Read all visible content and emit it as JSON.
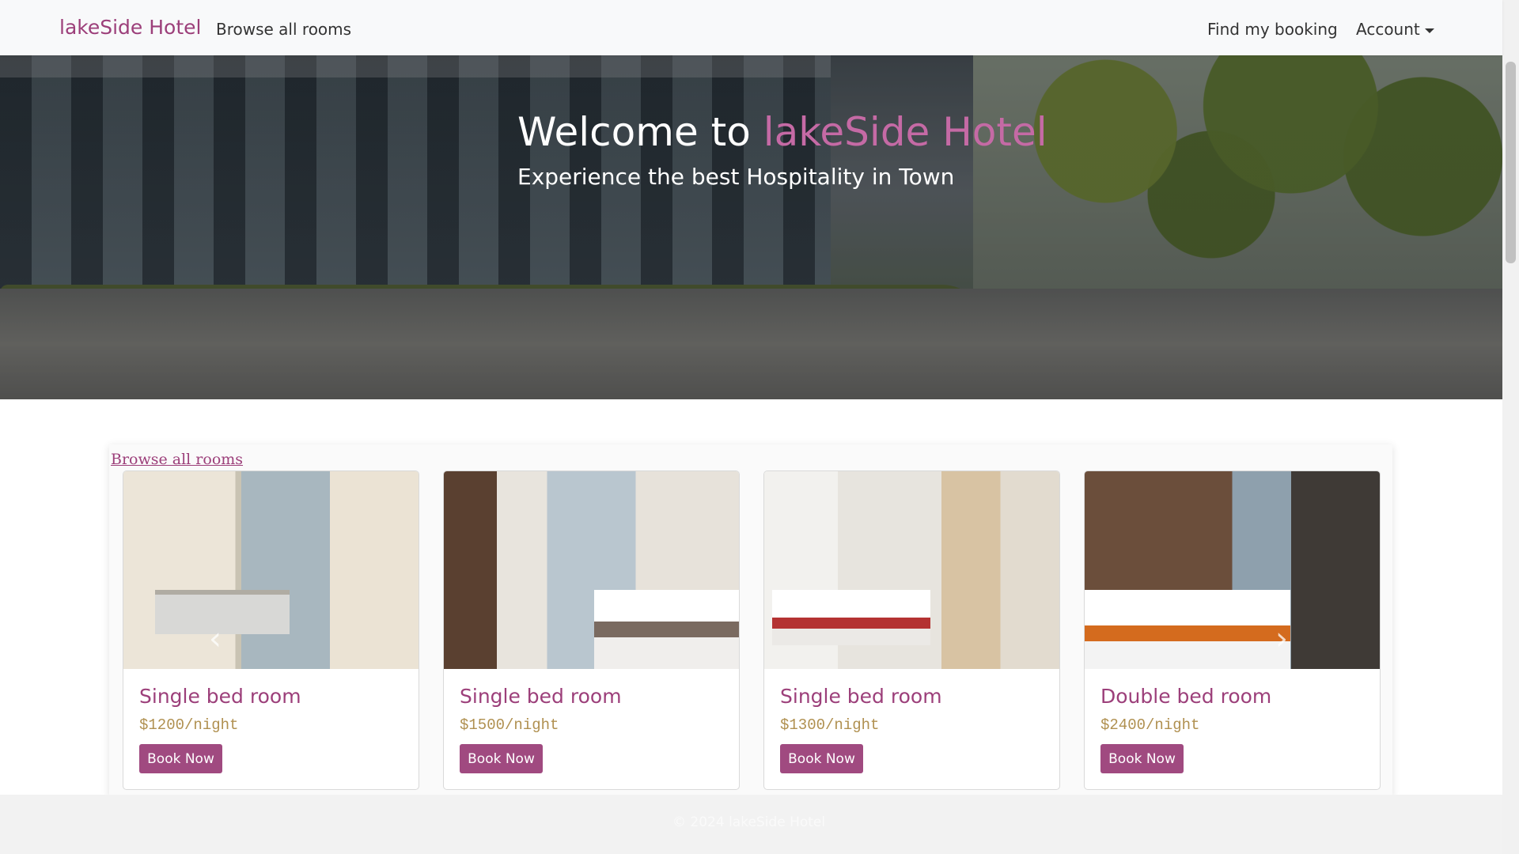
{
  "navbar": {
    "brand": "lakeSide Hotel",
    "browse_rooms": "Browse all rooms",
    "find_booking": "Find my booking",
    "account": "Account"
  },
  "hero": {
    "title_prefix": "Welcome to",
    "title_accent": "lakeSide Hotel",
    "subtitle": "Experience the best Hospitality in Town"
  },
  "rooms_section": {
    "browse_link": "Browse all rooms",
    "prev_arrow": "‹",
    "next_arrow": "›",
    "rooms": [
      {
        "title": "Single bed room",
        "price": "$1200/night",
        "button": "Book Now"
      },
      {
        "title": "Single bed room",
        "price": "$1500/night",
        "button": "Book Now"
      },
      {
        "title": "Single bed room",
        "price": "$1300/night",
        "button": "Book Now"
      },
      {
        "title": "Double bed room",
        "price": "$2400/night",
        "button": "Book Now"
      }
    ]
  },
  "footer": {
    "copyright": "© 2024 lakeSide Hotel"
  },
  "colors": {
    "brand": "#9c3f7a",
    "button": "#a04a80",
    "price": "#b09050"
  }
}
